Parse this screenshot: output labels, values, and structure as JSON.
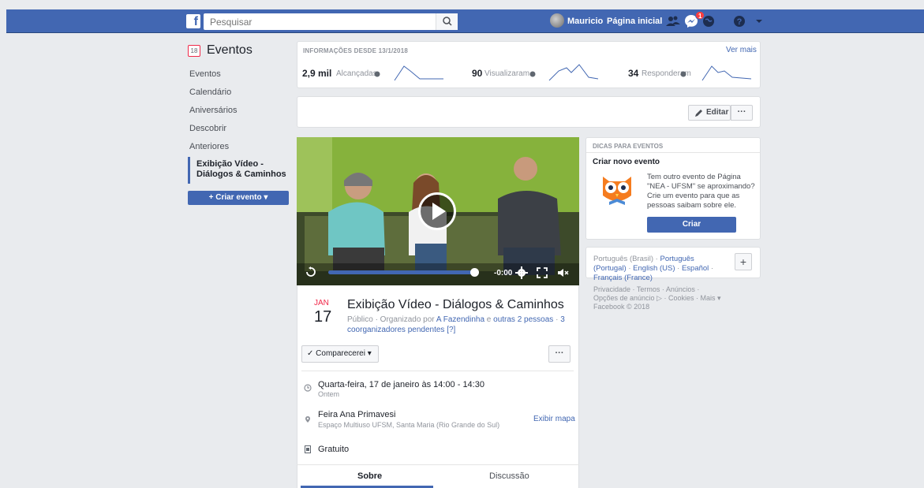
{
  "topbar": {
    "logo": "f",
    "search_placeholder": "Pesquisar",
    "user_name": "Mauricio",
    "home_label": "Página inicial",
    "notif_count": "1"
  },
  "nav": {
    "title": "Eventos",
    "calendar_day": "18",
    "items": [
      "Eventos",
      "Calendário",
      "Aniversários",
      "Descobrir",
      "Anteriores"
    ],
    "active_line1": "Exibição Vídeo -",
    "active_line2": "Diálogos & Caminhos",
    "create_label": "+ Criar evento ▾"
  },
  "insights": {
    "label": "INFORMAÇÕES DESDE 13/1/2018",
    "see_more": "Ver mais",
    "stats": [
      {
        "value": "2,9 mil",
        "label": "Alcançadas"
      },
      {
        "value": "90",
        "label": "Visualizaram"
      },
      {
        "value": "34",
        "label": "Responderam"
      }
    ]
  },
  "editbar": {
    "edit_label": "Editar",
    "more_label": "···"
  },
  "video": {
    "time": "-0:00",
    "progress": 0.96
  },
  "event": {
    "month": "JAN",
    "day": "17",
    "title": "Exibição Vídeo - Diálogos & Caminhos",
    "sub_prefix": "Público · Organizado por ",
    "organizer": "A Fazendinha",
    "sub_and": " e ",
    "others": "outras 2 pessoas",
    "sub_sep": " · ",
    "pending": "3 coorganizadores pendentes [?]",
    "going_label": "✓ Comparecerei ▾",
    "more_label": "···",
    "when": "Quarta-feira, 17 de janeiro às 14:00 - 14:30",
    "when_sub": "Ontem",
    "where": "Feira Ana Primavesi",
    "where_sub": "Espaço Multiuso UFSM, Santa Maria (Rio Grande do Sul)",
    "map_link": "Exibir mapa",
    "price": "Gratuito",
    "tabs": [
      "Sobre",
      "Discussão"
    ]
  },
  "tips": {
    "header": "DICAS PARA EVENTOS",
    "title": "Criar novo evento",
    "body": "Tem outro evento de Página \"NEA - UFSM\" se aproximando? Crie um evento para que as pessoas saibam sobre ele.",
    "button": "Criar"
  },
  "langs": {
    "current": "Português (Brasil)",
    "sep": " · ",
    "l1": "Português (Portugal)",
    "l2": "English (US)",
    "l3": "Español",
    "l4": "Français (France)",
    "add": "+"
  },
  "footer": {
    "line1": "Privacidade · Termos · Anúncios ·",
    "line2": "Opções de anúncio ▷ · Cookies · Mais ▾",
    "line3": "Facebook © 2018"
  },
  "colors": {
    "brand": "#4267b2",
    "background": "#e9ebee",
    "accent_red": "#f02849"
  }
}
